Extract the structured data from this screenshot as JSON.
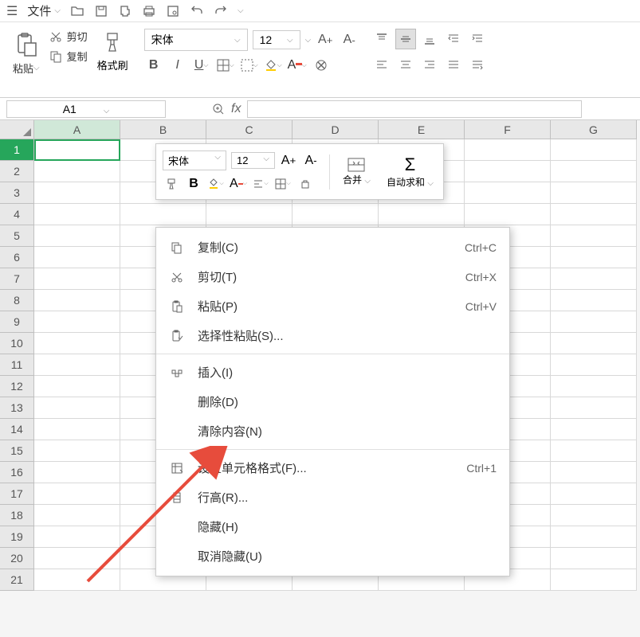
{
  "topbar": {
    "file_label": "文件"
  },
  "ribbon": {
    "paste_label": "粘贴",
    "cut_label": "剪切",
    "copy_label": "复制",
    "format_painter_label": "格式刷",
    "font_name": "宋体",
    "font_size": "12"
  },
  "cell_ref": "A1",
  "mini_toolbar": {
    "font_name": "宋体",
    "font_size": "12",
    "merge_label": "合并",
    "autosum_label": "自动求和"
  },
  "context_menu": {
    "items": [
      {
        "icon": "copy",
        "label": "复制(C)",
        "shortcut": "Ctrl+C"
      },
      {
        "icon": "cut",
        "label": "剪切(T)",
        "shortcut": "Ctrl+X"
      },
      {
        "icon": "paste",
        "label": "粘贴(P)",
        "shortcut": "Ctrl+V"
      },
      {
        "icon": "paste-special",
        "label": "选择性粘贴(S)...",
        "shortcut": ""
      },
      {
        "sep": true
      },
      {
        "icon": "insert",
        "label": "插入(I)",
        "shortcut": ""
      },
      {
        "icon": "",
        "label": "删除(D)",
        "shortcut": ""
      },
      {
        "icon": "",
        "label": "清除内容(N)",
        "shortcut": ""
      },
      {
        "sep": true
      },
      {
        "icon": "format",
        "label": "设置单元格格式(F)...",
        "shortcut": "Ctrl+1"
      },
      {
        "icon": "row-height",
        "label": "行高(R)...",
        "shortcut": ""
      },
      {
        "icon": "",
        "label": "隐藏(H)",
        "shortcut": ""
      },
      {
        "icon": "",
        "label": "取消隐藏(U)",
        "shortcut": ""
      }
    ]
  },
  "columns": [
    "A",
    "B",
    "C",
    "D",
    "E",
    "F",
    "G"
  ],
  "rows": [
    "1",
    "2",
    "3",
    "4",
    "5",
    "6",
    "7",
    "8",
    "9",
    "10",
    "11",
    "12",
    "13",
    "14",
    "15",
    "16",
    "17",
    "18",
    "19",
    "20",
    "21"
  ]
}
